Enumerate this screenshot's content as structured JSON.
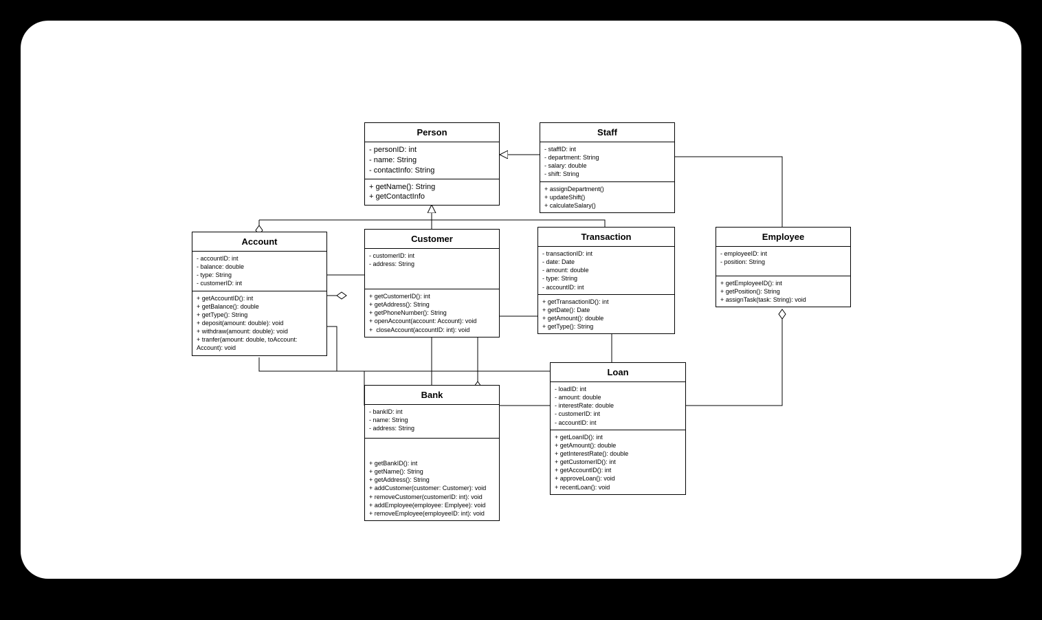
{
  "classes": {
    "person": {
      "name": "Person",
      "attributes": [
        "- personID: int",
        "- name: String",
        "- contactInfo: String"
      ],
      "methods": [
        "+ getName(): String",
        "+ getContactInfo"
      ]
    },
    "staff": {
      "name": "Staff",
      "attributes": [
        "- staffID: int",
        "- department: String",
        "- salary: double",
        "- shift: String"
      ],
      "methods": [
        "+ assignDepartment()",
        "+ updateShift()",
        "+ calculateSalary()"
      ]
    },
    "account": {
      "name": "Account",
      "attributes": [
        "- accountID: int",
        "- balance: double",
        "- type: String",
        "- customerID: int"
      ],
      "methods": [
        "+ getAccountID(): int",
        "+ getBalance(): double",
        "+ getType(): String",
        "+ deposit(amount: double): void",
        "+ withdraw(amount: double): void",
        "+ tranfer(amount: double, toAccount: Account): void"
      ]
    },
    "customer": {
      "name": "Customer",
      "attributes": [
        "- customerID: int",
        "- address: String"
      ],
      "methods": [
        "+ getCustomerID(): int",
        "+ getAddress(): String",
        "+ getPhoneNumber(): String",
        "+ openAccount(account: Account): void",
        "+  closeAccount(accountID: int): void"
      ]
    },
    "transaction": {
      "name": "Transaction",
      "attributes": [
        "- transactionID: int",
        "- date: Date",
        "- amount: double",
        "- type: String",
        "- accountID: int"
      ],
      "methods": [
        "+ getTransactionID(): int",
        "+ getDate(): Date",
        "+ getAmount(): double",
        "+ getType(): String"
      ]
    },
    "employee": {
      "name": "Employee",
      "attributes": [
        "- employeeID: int",
        "- position: String"
      ],
      "methods": [
        "+ getEmployeeID(): int",
        "+ getPosition(): String",
        "+ assignTask(task: String): void"
      ]
    },
    "loan": {
      "name": "Loan",
      "attributes": [
        "- loadID: int",
        "- amount: double",
        "- interestRate: double",
        "- customerID: int",
        "- accountID: int"
      ],
      "methods": [
        "+ getLoanID(): int",
        "+ getAmount(): double",
        "+ getInterestRate(): double",
        "+ getCustomerID(): int",
        "+ getAccountID(): int",
        "+ approveLoan(): void",
        "+ recentLoan(): void"
      ]
    },
    "bank": {
      "name": "Bank",
      "attributes": [
        "- bankID: int",
        "- name: String",
        "- address: String"
      ],
      "methods": [
        "+ getBankID(): int",
        "+ getName(): String",
        "+ getAddress(): String",
        "+ addCustomer(customer: Customer): void",
        "+ removeCustomer(customerID: int): void",
        "+ addEmployee(employee: Emplyee): void",
        "+ removeEmployee(employeeID: int): void"
      ]
    }
  }
}
